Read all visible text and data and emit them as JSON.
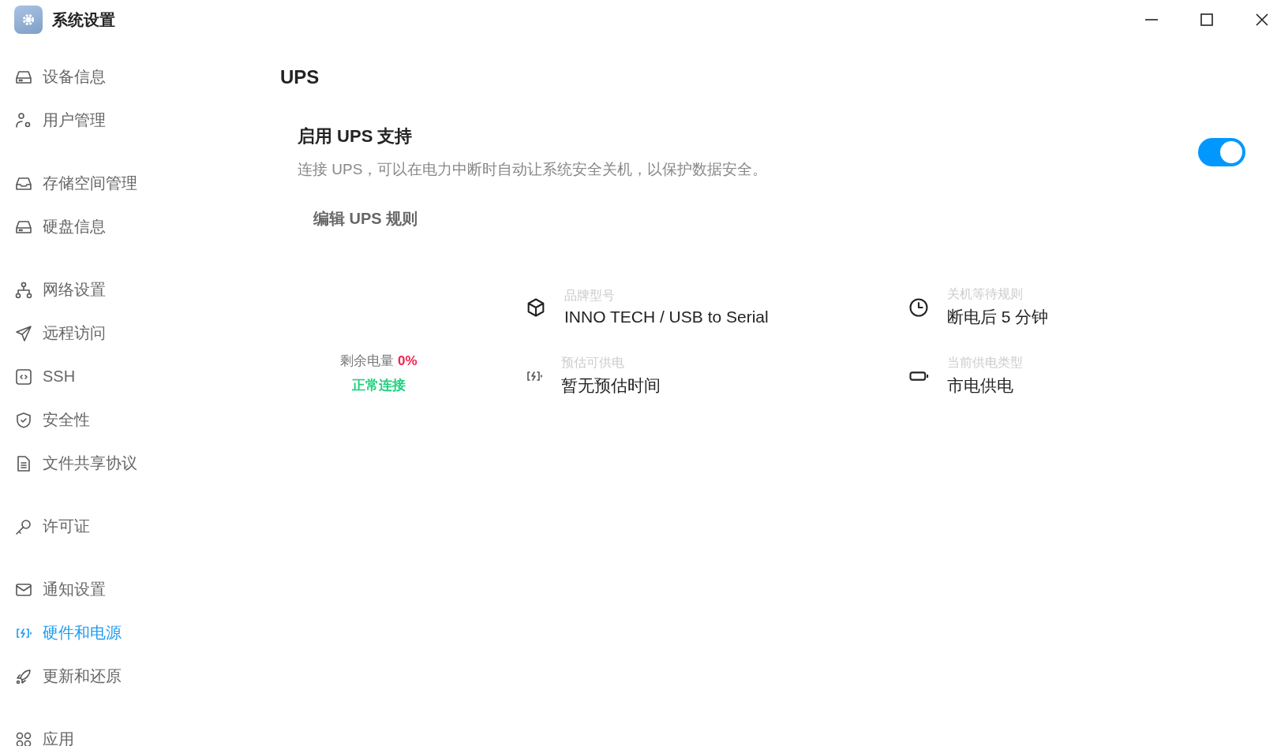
{
  "window": {
    "title": "系统设置"
  },
  "sidebar": {
    "groups": [
      [
        {
          "label": "设备信息",
          "selected": false
        },
        {
          "label": "用户管理",
          "selected": false
        }
      ],
      [
        {
          "label": "存储空间管理",
          "selected": false
        },
        {
          "label": "硬盘信息",
          "selected": false
        }
      ],
      [
        {
          "label": "网络设置",
          "selected": false
        },
        {
          "label": "远程访问",
          "selected": false
        },
        {
          "label": "SSH",
          "selected": false
        },
        {
          "label": "安全性",
          "selected": false
        },
        {
          "label": "文件共享协议",
          "selected": false
        }
      ],
      [
        {
          "label": "许可证",
          "selected": false
        }
      ],
      [
        {
          "label": "通知设置",
          "selected": false
        },
        {
          "label": "硬件和电源",
          "selected": true
        },
        {
          "label": "更新和还原",
          "selected": false
        }
      ],
      [
        {
          "label": "应用",
          "selected": false
        }
      ]
    ]
  },
  "page_title": "UPS",
  "ups_setting": {
    "title": "启用 UPS 支持",
    "description": "连接 UPS，可以在电力中断时自动让系统安全关机，以保护数据安全。",
    "on": true
  },
  "edit_button": "编辑 UPS 规则",
  "battery": {
    "label": "剩余电量",
    "value": "0%",
    "status": "正常连接"
  },
  "info": [
    {
      "label": "品牌型号",
      "value": "INNO TECH / USB to Serial"
    },
    {
      "label": "关机等待规则",
      "value": "断电后 5 分钟"
    },
    {
      "label": "预估可供电",
      "value": "暂无预估时间"
    },
    {
      "label": "当前供电类型",
      "value": "市电供电"
    }
  ]
}
